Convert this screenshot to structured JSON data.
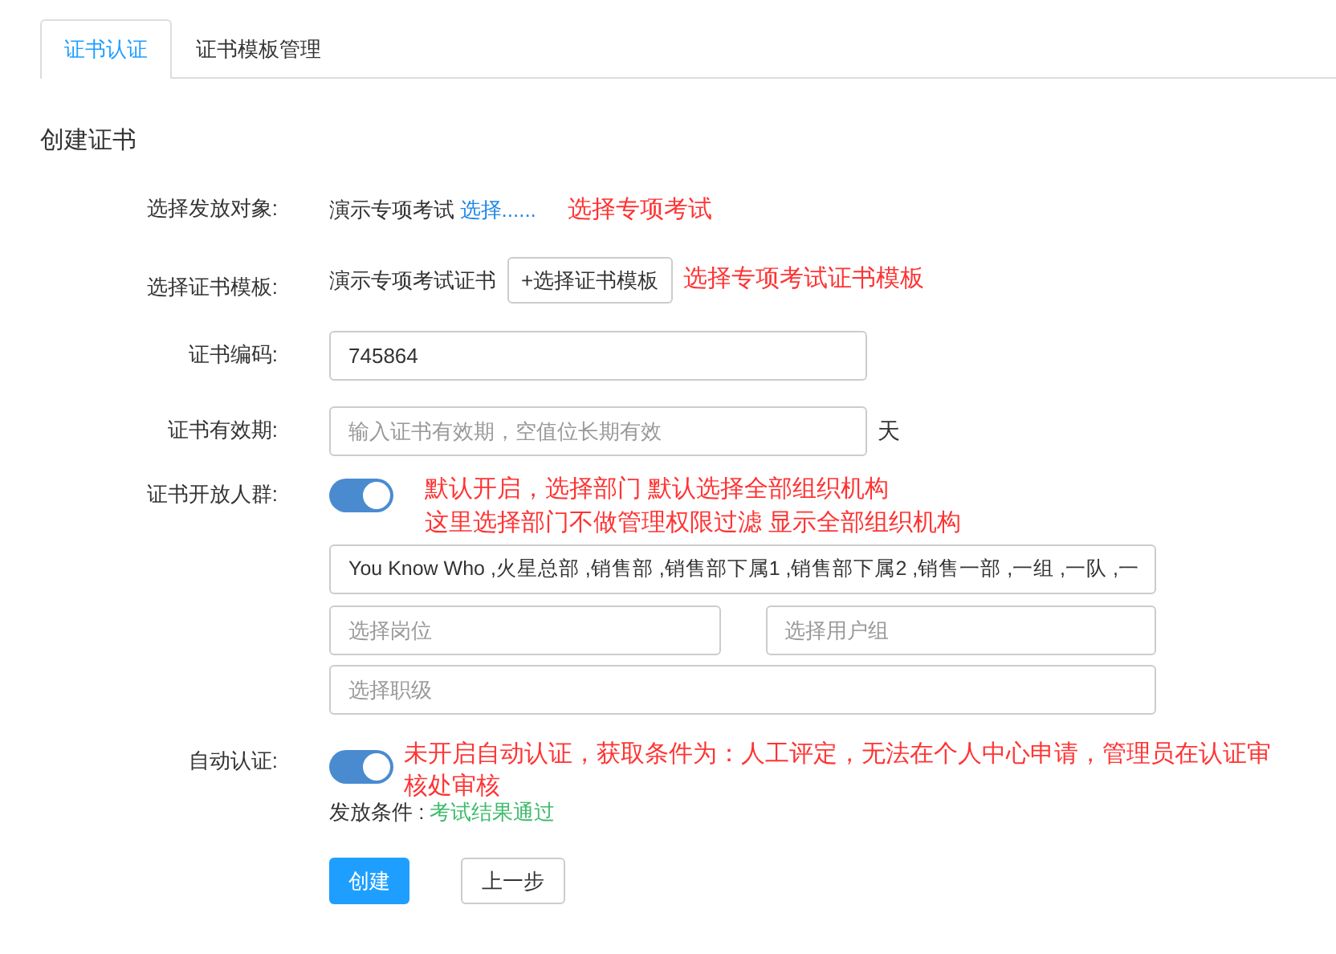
{
  "tabs": [
    {
      "label": "证书认证",
      "selected": true
    },
    {
      "label": "证书模板管理",
      "selected": false
    }
  ],
  "form": {
    "title": "创建证书",
    "target": {
      "label": "选择发放对象:",
      "value": "演示专项考试",
      "link": "选择......",
      "note": "选择专项考试"
    },
    "template": {
      "label": "选择证书模板:",
      "value": "演示专项考试证书",
      "button_icon": "+",
      "button": "选择证书模板",
      "note": "选择专项考试证书模板"
    },
    "code": {
      "label": "证书编码:",
      "value": "745864"
    },
    "validity": {
      "label": "证书有效期:",
      "placeholder": "输入证书有效期，空值位长期有效",
      "suffix": "天"
    },
    "audience": {
      "label": "证书开放人群:",
      "on": true,
      "note_lines": [
        "默认开启，选择部门 默认选择全部组织机构",
        "这里选择部门不做管理权限过滤 显示全部组织机构"
      ],
      "departments": "You Know Who ,火星总部 ,销售部 ,销售部下属1 ,销售部下属2 ,销售一部 ,一组 ,一队 ,一",
      "position_placeholder": "选择岗位",
      "group_placeholder": "选择用户组",
      "rank_placeholder": "选择职级"
    },
    "auto": {
      "label": "自动认证:",
      "on": true,
      "note": "未开启自动认证，获取条件为：人工评定，无法在个人中心申请，管理员在认证审核处审核",
      "condition_label": "发放条件 :",
      "condition_value": "考试结果通过"
    },
    "buttons": [
      {
        "label": "创建",
        "kind": "primary"
      },
      {
        "label": "上一步",
        "kind": "secondary"
      }
    ]
  }
}
